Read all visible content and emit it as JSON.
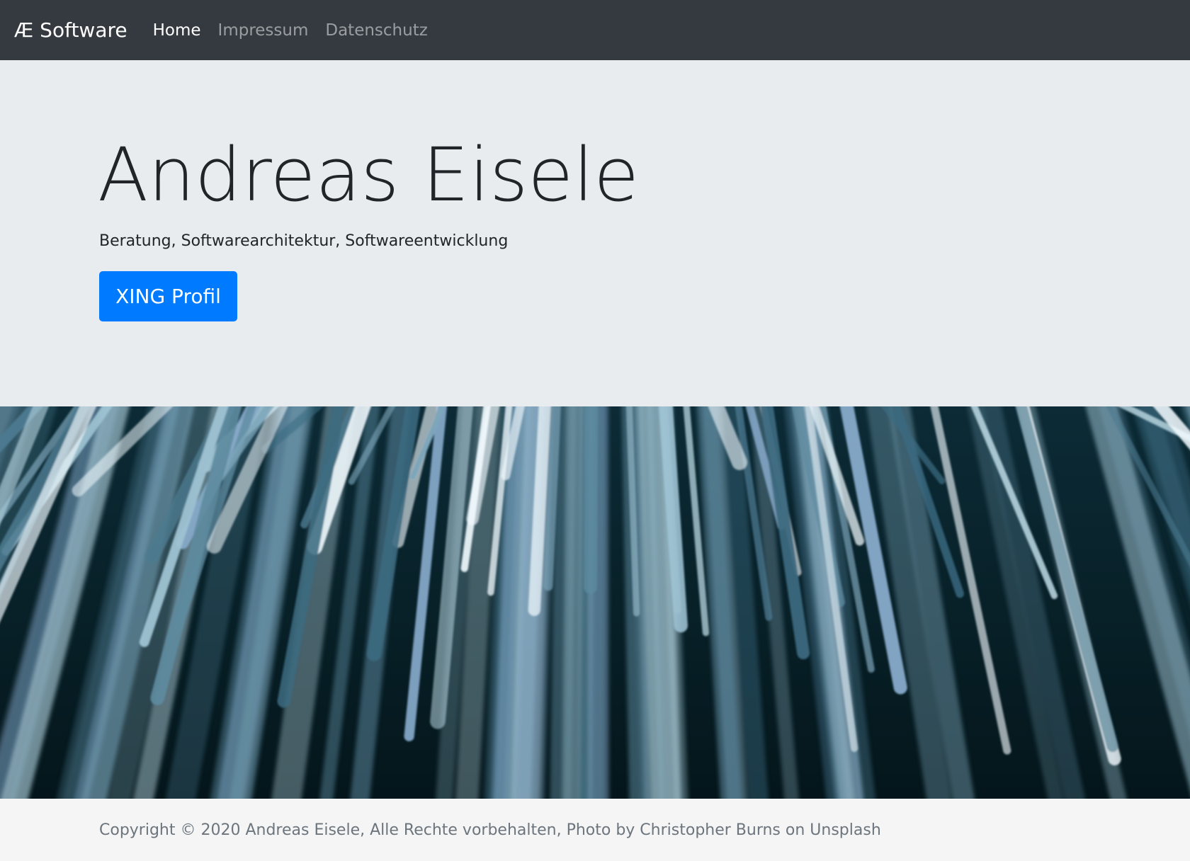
{
  "navbar": {
    "brand": "Æ Software",
    "links": [
      {
        "label": "Home",
        "active": true
      },
      {
        "label": "Impressum",
        "active": false
      },
      {
        "label": "Datenschutz",
        "active": false
      }
    ]
  },
  "hero": {
    "title": "Andreas Eisele",
    "lead": "Beratung, Softwarearchitektur, Softwareentwicklung",
    "button_label": "XING Profil"
  },
  "footer": {
    "text": "Copyright © 2020 Andreas Eisele, Alle Rechte vorbehalten, Photo by Christopher Burns on Unsplash"
  },
  "colors": {
    "navbar_bg": "#343a40",
    "jumbotron_bg": "#e9ecef",
    "primary": "#007bff",
    "footer_bg": "#f5f5f5"
  }
}
